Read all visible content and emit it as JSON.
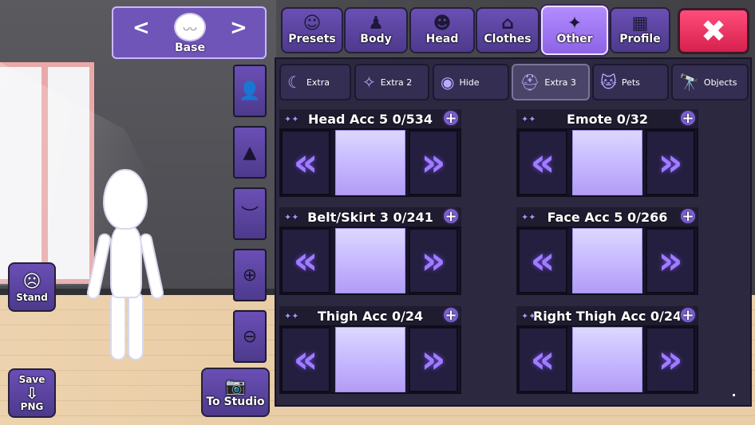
{
  "base_selector": {
    "prev": "<",
    "next": ">",
    "face": "◡◡",
    "label": "Base"
  },
  "tools": [
    {
      "icon": "add-person-icon",
      "glyph": "👤"
    },
    {
      "icon": "background-icon",
      "glyph": "▲"
    },
    {
      "icon": "eyes-closed-icon",
      "glyph": "︶"
    },
    {
      "icon": "zoom-in-icon",
      "glyph": "⊕"
    },
    {
      "icon": "zoom-out-icon",
      "glyph": "⊖"
    }
  ],
  "tabs": [
    {
      "label": "Presets",
      "icon": "preset-icon",
      "glyph": "☺"
    },
    {
      "label": "Body",
      "icon": "body-icon",
      "glyph": "♟"
    },
    {
      "label": "Head",
      "icon": "head-icon",
      "glyph": "☻"
    },
    {
      "label": "Clothes",
      "icon": "hanger-icon",
      "glyph": "⌂"
    },
    {
      "label": "Other",
      "icon": "magic-wand-icon",
      "glyph": "✦"
    },
    {
      "label": "Profile",
      "icon": "profile-card-icon",
      "glyph": "▦"
    }
  ],
  "close_glyph": "✖",
  "subtabs": [
    {
      "label": "Extra",
      "icon": "moon-icon",
      "glyph": "☾"
    },
    {
      "label": "Extra 2",
      "icon": "stars-icon",
      "glyph": "✧"
    },
    {
      "label": "Hide",
      "icon": "eye-icon",
      "glyph": "◉"
    },
    {
      "label": "Extra 3",
      "icon": "hat-icon",
      "glyph": "⛑"
    },
    {
      "label": "Pets",
      "icon": "cat-icon",
      "glyph": "🐱"
    },
    {
      "label": "Objects",
      "icon": "telescope-icon",
      "glyph": "🔭"
    }
  ],
  "slots": [
    {
      "title": "Head Acc 5 0/534"
    },
    {
      "title": "Emote 0/32"
    },
    {
      "title": "Belt/Skirt 3 0/241"
    },
    {
      "title": "Face Acc 5 0/266"
    },
    {
      "title": "Thigh Acc 0/24"
    },
    {
      "title": "Right Thigh Acc 0/24"
    }
  ],
  "slot_glyphs": {
    "spark": "✦✦",
    "plus": "+",
    "left": "«",
    "right": "»"
  },
  "buttons": {
    "stand": {
      "label": "Stand",
      "glyph": "☹"
    },
    "save": {
      "top": "Save",
      "glyph": "⇩",
      "bottom": "PNG"
    },
    "studio": {
      "label": "To Studio",
      "glyph": "📷"
    }
  },
  "colors": {
    "accent": "#8d63e6",
    "close": "#e3305c",
    "panel": "#2b2840"
  }
}
